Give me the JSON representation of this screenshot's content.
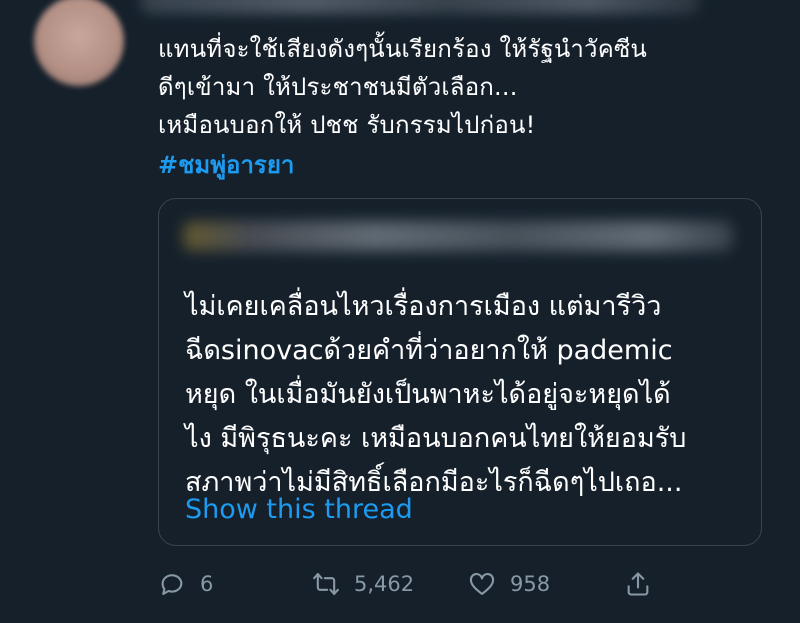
{
  "tweet": {
    "lines": [
      "แทนที่จะใช้เสียงดังๆนั้นเรียกร้อง ให้รัฐนำวัคซีน",
      "ดีๆเข้ามา ให้ประชาชนมีตัวเลือก...",
      "เหมือนบอกให้ ปชช รับกรรมไปก่อน!"
    ],
    "hashtag": "#ชมพู่อารยา"
  },
  "quote": {
    "lines": [
      "ไม่เคยเคลื่อนไหวเรื่องการเมือง แต่มารีวิว",
      "ฉีดsinovacด้วยคำที่ว่าอยากให้ pademic",
      "หยุด ในเมื่อมันยังเป็นพาหะได้อยู่จะหยุดได้",
      "ไง มีพิรุธนะคะ เหมือนบอกคนไทยให้ยอมรับ",
      "สภาพว่าไม่มีสิทธิ์เลือกมีอะไรก็ฉีดๆไปเถอ..."
    ],
    "show_thread": "Show this thread"
  },
  "actions": {
    "reply_count": "6",
    "retweet_count": "5,462",
    "like_count": "958"
  },
  "icons": {
    "reply": "reply-icon",
    "retweet": "retweet-icon",
    "like": "heart-icon",
    "share": "share-icon"
  },
  "colors": {
    "background": "#15202b",
    "link": "#1d9bf0",
    "muted": "#8899a6",
    "border": "#38444d"
  }
}
